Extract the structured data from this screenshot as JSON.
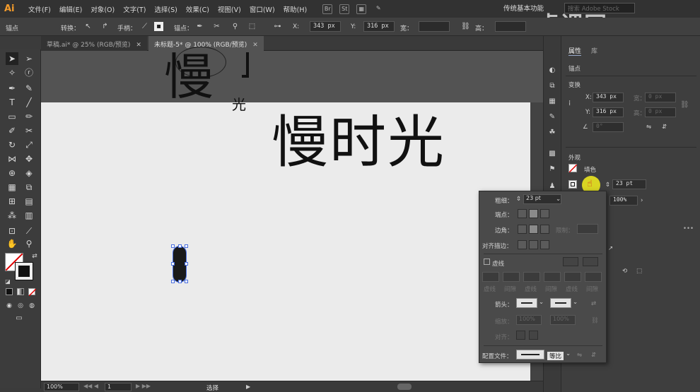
{
  "app": {
    "logo": "Ai"
  },
  "menu": [
    "文件(F)",
    "编辑(E)",
    "对象(O)",
    "文字(T)",
    "选择(S)",
    "效果(C)",
    "视图(V)",
    "窗口(W)",
    "帮助(H)"
  ],
  "menubar_icons": [
    "Br",
    "St"
  ],
  "workspace": "传统基本功能",
  "stock_search_placeholder": "搜索 Adobe Stock",
  "control": {
    "context": "锚点",
    "convert_label": "转换：",
    "handle_label": "手柄：",
    "anchor_label": "锚点：",
    "x_label": "X:",
    "x_value": "343 px",
    "y_label": "Y:",
    "y_value": "316 px",
    "w_label": "宽：",
    "h_label": "高："
  },
  "tabs": [
    {
      "label": "草稿.ai* @ 25% (RGB/预览)"
    },
    {
      "label": "未标题-5* @ 100% (RGB/预览)"
    }
  ],
  "canvas": {
    "overflow_big_char": "慢",
    "overflow_small_char": "光",
    "title_text": "慢时光"
  },
  "status": {
    "zoom": "100%",
    "artboard_num": "1",
    "tool": "选择"
  },
  "properties": {
    "tab_properties": "属性",
    "tab_library": "库",
    "section_anchor": "锚点",
    "section_transform": "变换",
    "x_label": "X:",
    "x_value": "343 px",
    "y_label": "Y:",
    "y_value": "316 px",
    "w_label": "宽：",
    "w_value": "0 px",
    "h_label": "高：",
    "h_value": "0 px",
    "angle_value": "0°",
    "section_appearance": "外观",
    "fill_label": "填色",
    "stroke_value": "23 pt",
    "opacity_value": "100%"
  },
  "stroke_panel": {
    "weight_label": "粗细：",
    "weight_value": "23 pt",
    "cap_label": "端点：",
    "corner_label": "边角：",
    "limit_label": "限制：",
    "align_label": "对齐描边：",
    "dashed_label": "虚线",
    "dash_cols": [
      "虚线",
      "间隙",
      "虚线",
      "间隙",
      "虚线",
      "间隙"
    ],
    "arrow_label": "箭头：",
    "scale_label": "缩放：",
    "scale_value1": "100%",
    "scale_value2": "100%",
    "align_arrow_label": "对齐：",
    "profile_label": "配置文件：",
    "profile_value": "等比"
  },
  "colors": {
    "accent_orange": "#f39b2b",
    "selection_blue": "#4a6fe0",
    "cursor_highlight": "#f5f01e"
  }
}
